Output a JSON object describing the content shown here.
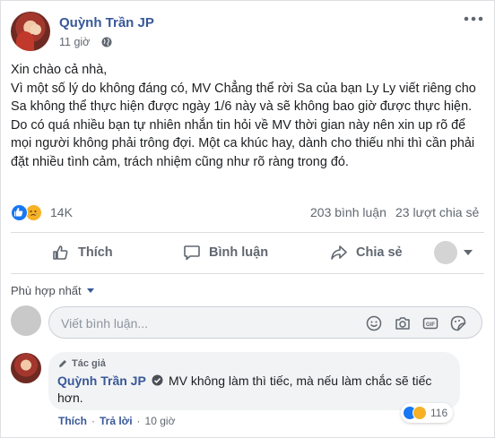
{
  "post": {
    "author": "Quỳnh Trần JP",
    "time": "11 giờ",
    "text_lines": [
      "Xin chào cả nhà,",
      "Vì một số lý do không đáng có, MV Chẳng thể rời Sa của bạn Ly Ly viết riêng cho Sa không thể thực hiện được ngày 1/6 này và sẽ không bao giờ được thực hiện.",
      "Do có quá nhiều bạn tự nhiên nhắn tin hỏi về MV thời gian này nên xin up rõ để mọi người không phải trông đợi. Một ca khúc hay, dành cho thiếu nhi thì cần phải đặt nhiều tình cảm, trách nhiệm cũng như rõ ràng trong đó."
    ],
    "reaction_count": "14K",
    "comment_count": "203 bình luận",
    "share_count": "23 lượt chia sẻ"
  },
  "actions": {
    "like": "Thích",
    "comment": "Bình luận",
    "share": "Chia sẻ"
  },
  "comments": {
    "sort_label": "Phù hợp nhất",
    "input_placeholder": "Viết bình luận...",
    "items": [
      {
        "author_tag": "Tác giả",
        "author": "Quỳnh Trần JP",
        "text_line1": "MV không làm thì tiếc, mà nếu làm chắc sẽ tiếc",
        "text_line2": "hơn.",
        "reactions": "116",
        "like_label": "Thích",
        "reply_label": "Trả lời",
        "time": "10 giờ"
      }
    ]
  },
  "colors": {
    "link": "#385898",
    "like_blue": "#1877f2",
    "sad_yellow": "#f7b125",
    "muted": "#606770"
  },
  "icons": [
    "globe-icon",
    "more-icon",
    "thumbs-up-icon",
    "comment-icon",
    "share-icon",
    "emoji-icon",
    "camera-icon",
    "gif-icon",
    "sticker-icon",
    "pencil-icon",
    "verified-icon"
  ]
}
